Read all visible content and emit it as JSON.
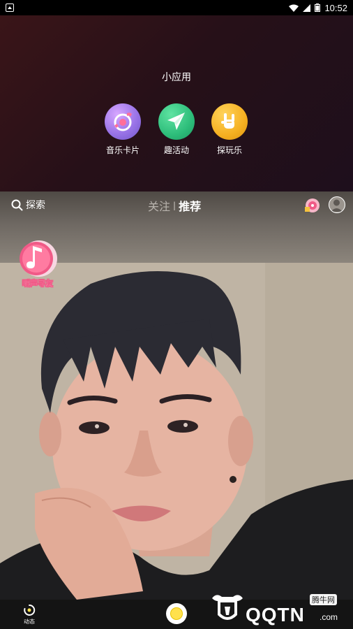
{
  "status_bar": {
    "time": "10:52"
  },
  "mini_apps_panel": {
    "title": "小应用",
    "apps": [
      {
        "label": "音乐卡片",
        "icon": "music-card-icon",
        "color": "#8b6fd8"
      },
      {
        "label": "趣活动",
        "icon": "paper-plane-icon",
        "color": "#2dbd7a"
      },
      {
        "label": "探玩乐",
        "icon": "rock-hand-icon",
        "color": "#f5b021"
      }
    ]
  },
  "top_nav": {
    "search_label": "探索",
    "tab_follow": "关注",
    "tab_recommend": "推荐"
  },
  "feed": {
    "badge_label": "听声寻友"
  },
  "bottom_nav": {
    "dynamic_label": "动态"
  },
  "watermark": {
    "brand": "QQTN",
    "dotcom": ".com",
    "sub": "腾牛网"
  },
  "colors": {
    "accent_pink": "#f05a87",
    "record_yellow": "#ffe14d"
  }
}
